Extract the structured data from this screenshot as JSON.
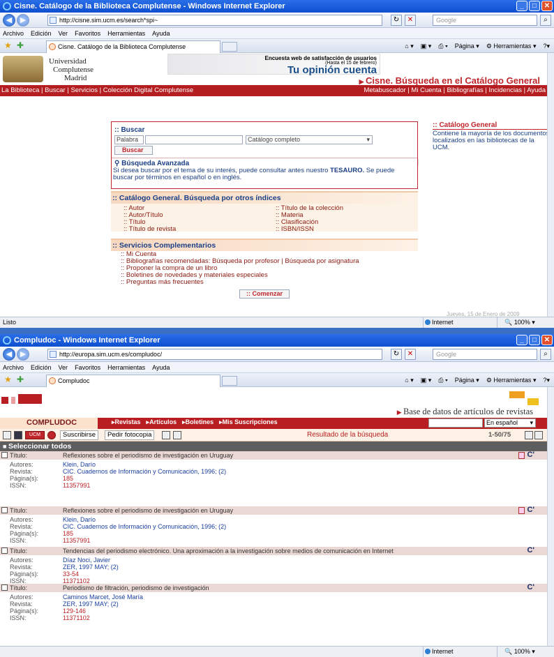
{
  "w1": {
    "title": "Cisne. Catálogo de la Biblioteca Complutense - Windows Internet Explorer",
    "url": "http://cisne.sim.ucm.es/search*spi~",
    "search_placeholder": "Google",
    "menu": [
      "Archivo",
      "Edición",
      "Ver",
      "Favoritos",
      "Herramientas",
      "Ayuda"
    ],
    "tab": "Cisne. Catálogo de la Biblioteca Complutense",
    "tools": [
      "Página",
      "Herramientas"
    ],
    "univ": [
      "Universidad",
      "Complutense",
      "Madrid"
    ],
    "banner": {
      "line1": "Encuesta web de satisfacción de usuarios",
      "line2": "(Hasta el 15 de febrero)",
      "line3": "Tu opinión cuenta"
    },
    "site_title": "Cisne. Búsqueda en el Catálogo General",
    "nav_left": "La Biblioteca | Buscar | Servicios | Colección Digital Complutense",
    "nav_right": "Metabuscador | Mi Cuenta | Bibliografías | Incidencias | Ayuda",
    "buscar": {
      "title": ":: Buscar",
      "field": "Palabra",
      "scope": "Catálogo completo",
      "button": "Buscar",
      "advanced": "Búsqueda Avanzada",
      "hint_pre": "Si desea buscar por el tema de su interés, puede consultar antes nuestro ",
      "hint_bold": "TESAURO.",
      "hint_post": " Se puede buscar por términos en español o en inglés."
    },
    "indices": {
      "title": ":: Catálogo General. Búsqueda por otros índices",
      "left": [
        ":: Autor",
        ":: Autor/Título",
        ":: Título",
        ":: Título de revista"
      ],
      "right": [
        ":: Título de la colección",
        ":: Materia",
        ":: Clasificación",
        ":: ISBN/ISSN"
      ]
    },
    "servicios": {
      "title": ":: Servicios Complementarios",
      "items": [
        ":: Mi Cuenta",
        ":: Bibliografías recomendadas: Búsqueda por profesor | Búsqueda por asignatura",
        ":: Proponer la compra de un libro",
        ":: Boletines de novedades y materiales especiales",
        ":: Preguntas más frecuentes"
      ]
    },
    "comenzar": ":: Comenzar",
    "side": {
      "title": ":: Catálogo General",
      "text": "Contiene la mayoría de los documentos localizados en las bibliotecas de la UCM."
    },
    "date": "Jueves, 15 de Enero de 2009",
    "status": "Listo",
    "zone": "Internet",
    "zoom": "100%"
  },
  "w2": {
    "title": "Compludoc - Windows Internet Explorer",
    "url": "http://europa.sim.ucm.es/compludoc/",
    "search_placeholder": "Google",
    "menu": [
      "Archivo",
      "Edición",
      "Ver",
      "Favoritos",
      "Herramientas",
      "Ayuda"
    ],
    "tab": "Compludoc",
    "tools": [
      "Página",
      "Herramientas"
    ],
    "db_title": "Base de datos de artículos de revistas",
    "app_name": "COMPLUDOC",
    "nav": [
      "▸Revistas",
      "▸Artículos",
      "▸Boletines",
      "▸Mis Suscripciones"
    ],
    "lang": "En español",
    "toolbar": {
      "subscribe": "Suscribirse",
      "photocopy": "Pedir fotocopia",
      "ucm": "UCM",
      "result": "Resultado de la búsqueda",
      "paging": "1-50/75"
    },
    "select_all": "Seleccionar todos",
    "labels": {
      "title": "Título:",
      "authors": "Autores:",
      "journal": "Revista:",
      "pages": "Página(s):",
      "issn": "ISSN:"
    },
    "records": [
      {
        "title": "Reflexiones sobre el periodismo de investigación en Uruguay",
        "authors": "Klein, Darío",
        "journal": "CIC. Cuadernos de Información y Comunicación, 1996; (2)",
        "pages": "185",
        "issn": "11357991"
      },
      {
        "title": "Reflexiones sobre el periodismo de investigación en Uruguay",
        "authors": "Klein, Darío",
        "journal": "CIC. Cuadernos de Información y Comunicación, 1996; (2)",
        "pages": "185",
        "issn": "11357991"
      },
      {
        "title": "Tendencias del periodismo electrónico. Una aproximación a la investigación sobre medios de comunicación en Internet",
        "authors": "Díaz Noci, Javier",
        "journal": "ZER, 1997 MAY; (2)",
        "pages": "33-54",
        "issn": "11371102"
      },
      {
        "title": "Periodismo de filtración, periodismo de investigación",
        "authors": "Caminos Marcet, José María",
        "journal": "ZER, 1997 MAY; (2)",
        "pages": "129-146",
        "issn": "11371102"
      }
    ],
    "zone": "Internet",
    "zoom": "100%"
  }
}
